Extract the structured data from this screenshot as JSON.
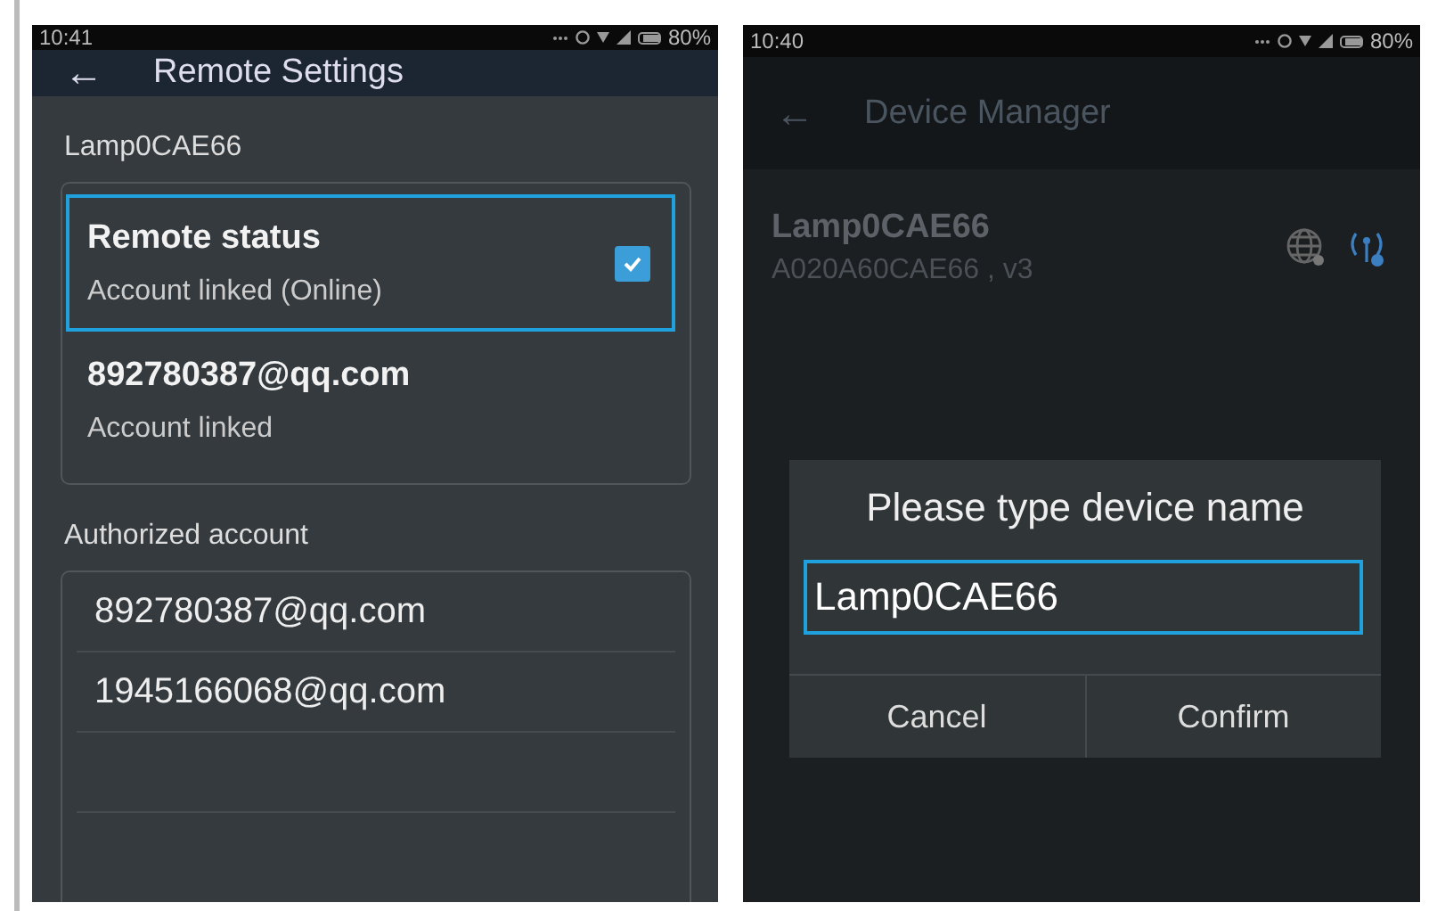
{
  "left_screen": {
    "status_bar": {
      "time": "10:41",
      "battery": "80%"
    },
    "toolbar": {
      "back": "←",
      "title": "Remote Settings"
    },
    "device_name": "Lamp0CAE66",
    "remote_card": [
      {
        "kind": "check",
        "title": "Remote status",
        "subtitle": "Account linked (Online)",
        "checked": true,
        "selected": true
      },
      {
        "kind": "plain",
        "title": "892780387@qq.com",
        "subtitle": "Account linked",
        "selected": false
      }
    ],
    "section_label": "Authorized account",
    "accounts": [
      "892780387@qq.com",
      "1945166068@qq.com"
    ]
  },
  "right_screen": {
    "status_bar": {
      "time": "10:40",
      "battery": "80%"
    },
    "toolbar": {
      "back": "←",
      "title": "Device Manager"
    },
    "device": {
      "name": "Lamp0CAE66",
      "detail": "A020A60CAE66 , v3"
    },
    "dialog": {
      "title": "Please type device name",
      "value": "Lamp0CAE66",
      "buttons": [
        "Cancel",
        "Confirm"
      ]
    }
  }
}
